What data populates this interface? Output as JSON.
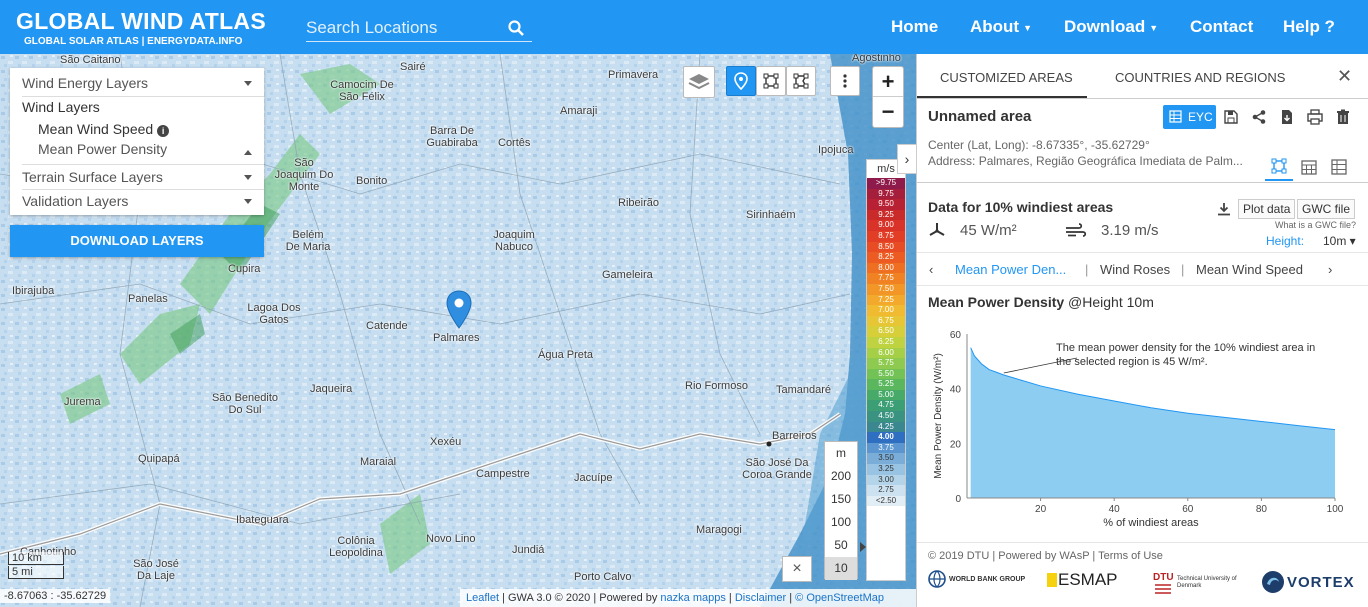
{
  "header": {
    "title": "GLOBAL WIND ATLAS",
    "subtitle": "GLOBAL SOLAR ATLAS  |  ENERGYDATA.INFO",
    "search_placeholder": "Search Locations",
    "nav": [
      "Home",
      "About",
      "Download",
      "Contact",
      "Help ?"
    ]
  },
  "layers_panel": {
    "wind_energy_layers": "Wind Energy Layers",
    "wind_layers": "Wind Layers",
    "mean_wind_speed": "Mean Wind Speed",
    "mean_power_density": "Mean Power Density",
    "terrain_surface_layers": "Terrain Surface Layers",
    "validation_layers": "Validation Layers",
    "download_button": "DOWNLOAD LAYERS"
  },
  "map": {
    "places": [
      "Agostinho",
      "São Caitano",
      "Camocim De São Félix",
      "Sairé",
      "Primavera",
      "Amaraji",
      "Barra De Guabiraba",
      "Cortês",
      "Ipojuca",
      "São Joaquim Do Monte",
      "Bonito",
      "Ribeirão",
      "Sirinhaém",
      "Belém De Maria",
      "Joaquim Nabuco",
      "Cupira",
      "Gameleira",
      "Ibirajuba",
      "Panelas",
      "Lagoa Dos Gatos",
      "Catende",
      "Palmares",
      "Água Preta",
      "Rio Formoso",
      "Tamandaré",
      "Jurema",
      "São Benedito Do Sul",
      "Jaqueira",
      "Xexéu",
      "Barreiros",
      "Quipapá",
      "Maraial",
      "Campestre",
      "Jacuípe",
      "São José Da Coroa Grande",
      "Ibateguara",
      "Colônia Leopoldina",
      "Novo Lino",
      "Maragogi",
      "Canhotinho",
      "São José Da Laje",
      "Jundiá",
      "Porto Calvo"
    ],
    "marker_label": "Palmares",
    "zoom_in": "+",
    "zoom_out": "−",
    "legend_unit": "m/s",
    "legend_values": [
      ">9.75",
      "9.75",
      "9.50",
      "9.25",
      "9.00",
      "8.75",
      "8.50",
      "8.25",
      "8.00",
      "7.75",
      "7.50",
      "7.25",
      "7.00",
      "6.75",
      "6.50",
      "6.25",
      "6.00",
      "5.75",
      "5.50",
      "5.25",
      "5.00",
      "4.75",
      "4.50",
      "4.25",
      "4.00",
      "3.75",
      "3.50",
      "3.25",
      "3.00",
      "2.75",
      "<2.50"
    ],
    "legend_colors": [
      "#8e1b4b",
      "#a51e3c",
      "#b82134",
      "#c92a2a",
      "#d93228",
      "#e23e26",
      "#e84c24",
      "#ec5c22",
      "#ee6e22",
      "#f08224",
      "#f29628",
      "#f3a92c",
      "#f0bb30",
      "#e6c635",
      "#d6cf3a",
      "#bfd23f",
      "#a6cf48",
      "#8dca4f",
      "#72c256",
      "#5ab75e",
      "#47aa68",
      "#3b9e74",
      "#3a9280",
      "#3b878f",
      "#3b7fc8",
      "#5b96d0",
      "#7aaed9",
      "#98c3e2",
      "#b4d4ea",
      "#cde2f0",
      "#e2eef6"
    ],
    "legend_highlight": "4.00",
    "scale_unit": "m",
    "scale_values": [
      "200",
      "150",
      "100",
      "50",
      "10"
    ],
    "close": "×",
    "scalebar_km": "10 km",
    "scalebar_mi": "5 mi",
    "coords": "-8.67063 : -35.62729",
    "attribution": {
      "leaflet": "Leaflet",
      "gwa": " | GWA 3.0 © 2020 | Powered by ",
      "nazka": "nazka mapps",
      "sep": " | ",
      "disclaimer": "Disclaimer",
      "osm": "© OpenStreetMap"
    }
  },
  "panel": {
    "tab_custom": "CUSTOMIZED AREAS",
    "tab_countries": "COUNTRIES AND REGIONS",
    "area_title": "Unnamed area",
    "eyc_button": "EYC",
    "center": "Center (Lat, Long): -8.67335°, -35.62729°",
    "address": "Address: Palmares, Região Geográfica Imediata de Palm...",
    "data_title": "Data for 10% windiest areas",
    "plot_data": "Plot data",
    "gwc_file": "GWC file",
    "what_is_gwc": "What is a GWC file?",
    "power_density": "45 W/m²",
    "wind_speed": "3.19 m/s",
    "height_label": "Height:",
    "height_value": "10m ▾",
    "subtabs": [
      "Mean Power Den...",
      "Wind Roses",
      "Mean Wind Speed"
    ],
    "chart_heading": "Mean Power Density",
    "chart_heading_suffix": " @Height 10m",
    "footer": "© 2019  DTU  |  Powered by WAsP  |  Terms of Use",
    "logos": [
      "WORLD BANK GROUP",
      "ESMAP",
      "Technical University of Denmark",
      "VORTEX"
    ]
  },
  "chart_data": {
    "type": "area",
    "title": "",
    "xlabel": "% of windiest areas",
    "ylabel": "Mean Power Density (W/m²)",
    "xlim": [
      0,
      100
    ],
    "ylim": [
      0,
      60
    ],
    "xticks": [
      20,
      40,
      60,
      80,
      100
    ],
    "yticks": [
      0,
      20,
      40,
      60
    ],
    "x": [
      1,
      2,
      4,
      6,
      8,
      10,
      15,
      20,
      30,
      40,
      50,
      60,
      70,
      80,
      90,
      100
    ],
    "y": [
      55,
      52,
      49,
      47,
      46,
      45,
      43,
      41,
      38,
      35.5,
      33,
      31,
      29.5,
      28,
      26.5,
      25
    ],
    "annotation": "The mean power density for the 10% windiest area in the selected region is 45 W/m².",
    "fill_color": "#8ecdf2",
    "line_color": "#2196f3"
  }
}
